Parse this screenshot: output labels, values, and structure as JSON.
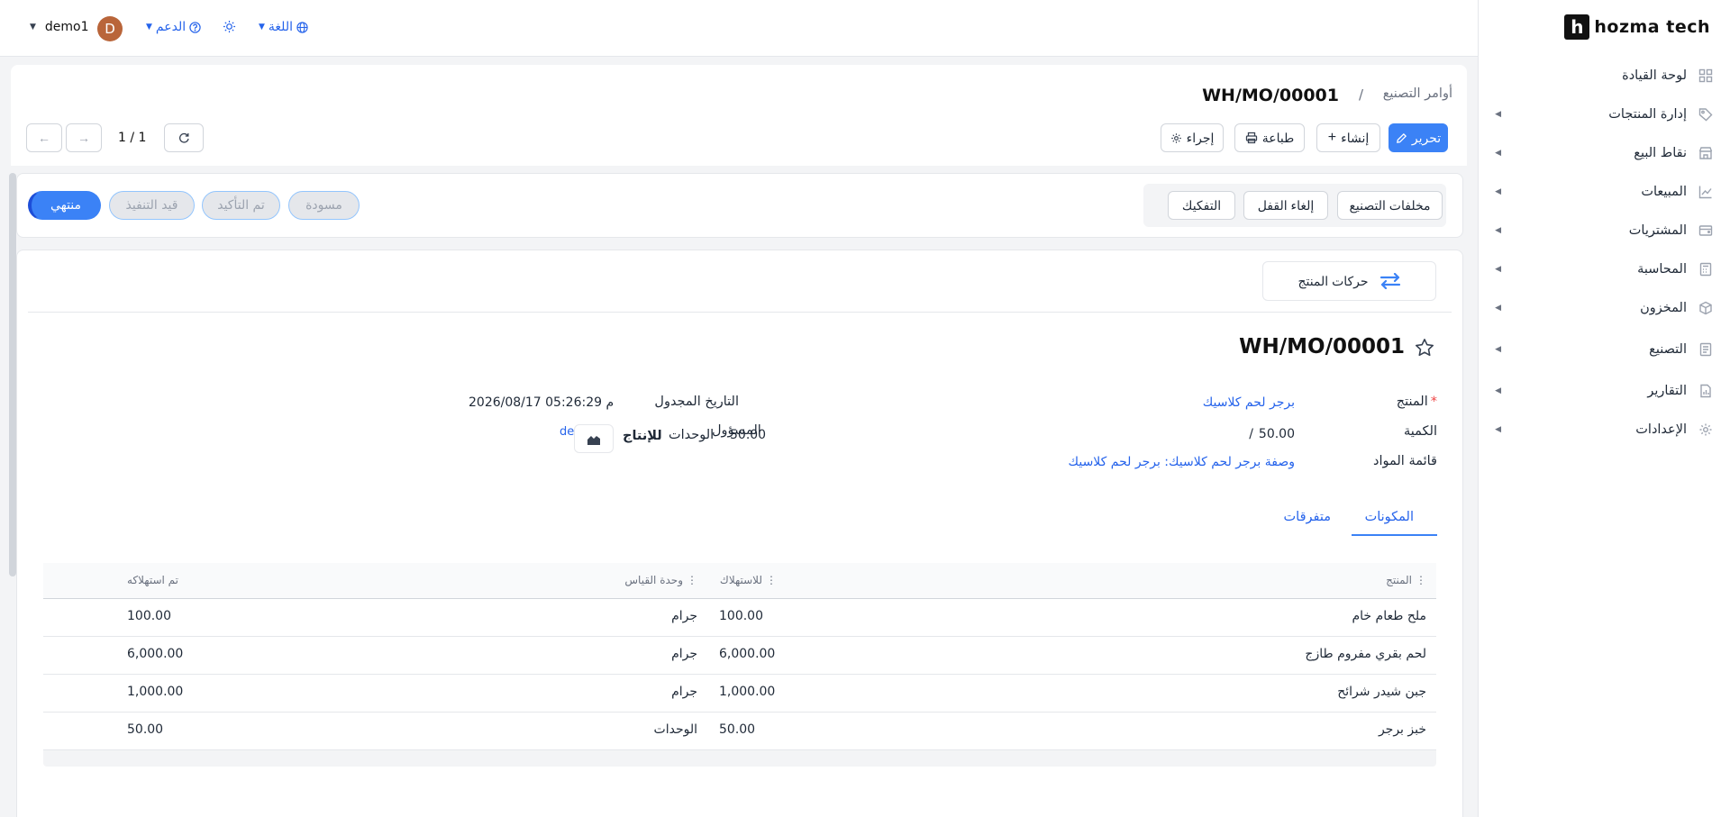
{
  "brand": {
    "name": "hozma tech",
    "mark": "h"
  },
  "sidebar": {
    "items": [
      {
        "label": "لوحة القيادة",
        "icon": "grid-icon",
        "has_submenu": false
      },
      {
        "label": "إدارة المنتجات",
        "icon": "tag-icon",
        "has_submenu": true
      },
      {
        "label": "نقاط البيع",
        "icon": "store-icon",
        "has_submenu": true
      },
      {
        "label": "المبيعات",
        "icon": "trend-icon",
        "has_submenu": true
      },
      {
        "label": "المشتريات",
        "icon": "wallet-icon",
        "has_submenu": true
      },
      {
        "label": "المحاسبة",
        "icon": "calculator-icon",
        "has_submenu": true
      },
      {
        "label": "المخزون",
        "icon": "box-icon",
        "has_submenu": true
      },
      {
        "label": "التصنيع",
        "icon": "document-icon",
        "has_submenu": true
      },
      {
        "label": "التقارير",
        "icon": "report-icon",
        "has_submenu": true
      },
      {
        "label": "الإعدادات",
        "icon": "gear-icon",
        "has_submenu": true
      }
    ]
  },
  "topbar": {
    "user": "demo1",
    "avatar_letter": "D",
    "support": "الدعم",
    "language": "اللغة"
  },
  "header": {
    "breadcrumb_parent": "أوامر التصنيع",
    "breadcrumb_sep": "/",
    "record": "WH/MO/00001",
    "pager": "1 / 1",
    "actions": {
      "edit": "تحرير",
      "create": "إنشاء",
      "print": "طباعة",
      "action": "إجراء"
    }
  },
  "statusbar": {
    "buttons": {
      "scrap": "مخلفات التصنيع",
      "unlock": "إلغاء القفل",
      "unbuild": "التفكيك"
    },
    "stages": [
      "مسودة",
      "تم التأكيد",
      "قيد التنفيذ",
      "منتهي"
    ],
    "active_stage": "منتهي"
  },
  "form": {
    "smart_button": "حركات المنتج",
    "title": "WH/MO/00001",
    "product_label": "المنتج",
    "product_value": "برجر لحم كلاسيك",
    "quantity_label": "الكمية",
    "quantity_value": "50.00",
    "quantity_sep": "/",
    "bom_label": "قائمة المواد",
    "bom_value": "وصفة برجر لحم كلاسيك: برجر لحم كلاسيك",
    "scheduled_label": "التاريخ المجدول",
    "scheduled_value": "2026/08/17 05:26:29 م",
    "responsible_label": "المسؤول",
    "units_label": "الوحدات",
    "to_produce_label": "للإنتاج",
    "to_produce_value": "50.00",
    "responsible_value": "de"
  },
  "tabs": {
    "components": "المكونات",
    "misc": "متفرقات"
  },
  "table": {
    "headers": {
      "product": "المنتج",
      "to_consume": "للاستهلاك",
      "uom": "وحدة القياس",
      "consumed": "تم استهلاكه"
    },
    "rows": [
      {
        "product": "ملح طعام خام",
        "to_consume": "100.00",
        "uom": "جرام",
        "consumed": "100.00"
      },
      {
        "product": "لحم بقري مفروم طازج",
        "to_consume": "6,000.00",
        "uom": "جرام",
        "consumed": "6,000.00"
      },
      {
        "product": "جبن شيدر شرائح",
        "to_consume": "1,000.00",
        "uom": "جرام",
        "consumed": "1,000.00"
      },
      {
        "product": "خبز برجر",
        "to_consume": "50.00",
        "uom": "الوحدات",
        "consumed": "50.00"
      }
    ]
  },
  "colors": {
    "primary": "#3b82f6",
    "link": "#2563eb",
    "avatar": "#b9653a"
  }
}
